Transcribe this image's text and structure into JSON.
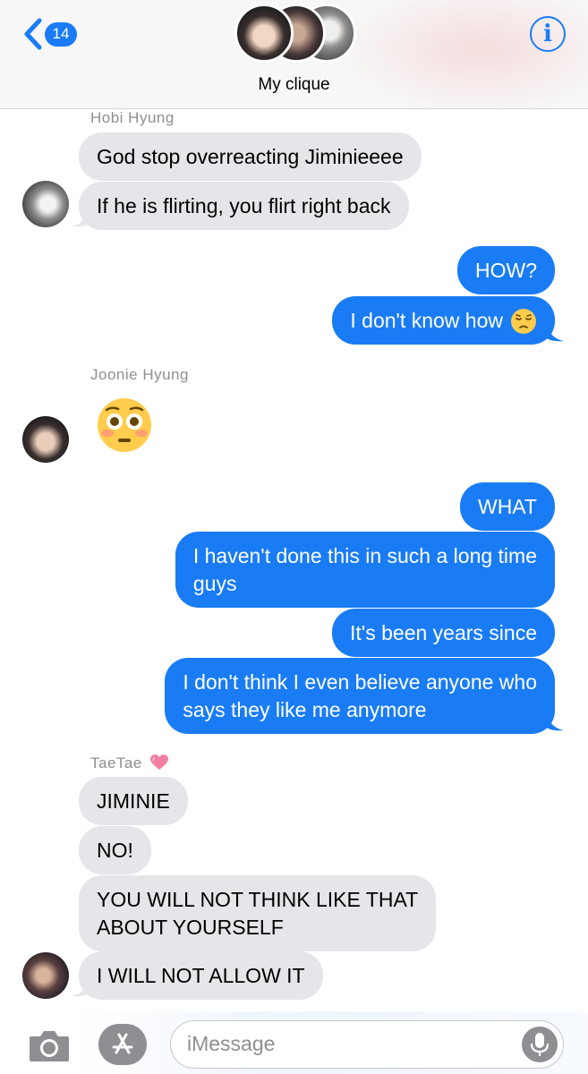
{
  "header": {
    "back_count": "14",
    "group_name": "My clique",
    "info_symbol": "i"
  },
  "messages": {
    "hobi": {
      "sender": "Hobi Hyung",
      "lines": [
        "God stop overreacting Jiminieeee",
        "If he is flirting, you flirt right back"
      ]
    },
    "me1": {
      "lines": [
        "HOW?",
        "I don't know how"
      ],
      "emoji": "pensive-face-icon"
    },
    "joonie": {
      "sender": "Joonie Hyung",
      "emoji": "flushed-face-icon"
    },
    "me2": {
      "lines": [
        "WHAT",
        "I haven't done this in such a long time",
        "guys",
        "It's been years since",
        "I don't think I even believe anyone who",
        "says they like me anymore"
      ]
    },
    "taetae": {
      "sender": "TaeTae",
      "lines": [
        "JIMINIE",
        "NO!",
        "YOU WILL NOT THINK LIKE THAT",
        "ABOUT YOURSELF",
        "I WILL NOT ALLOW IT"
      ]
    }
  },
  "composer": {
    "placeholder": "iMessage"
  },
  "colors": {
    "accent": "#1a7cf5",
    "incoming_bubble": "#e5e5ea",
    "outgoing_bubble": "#1a7cf5"
  }
}
